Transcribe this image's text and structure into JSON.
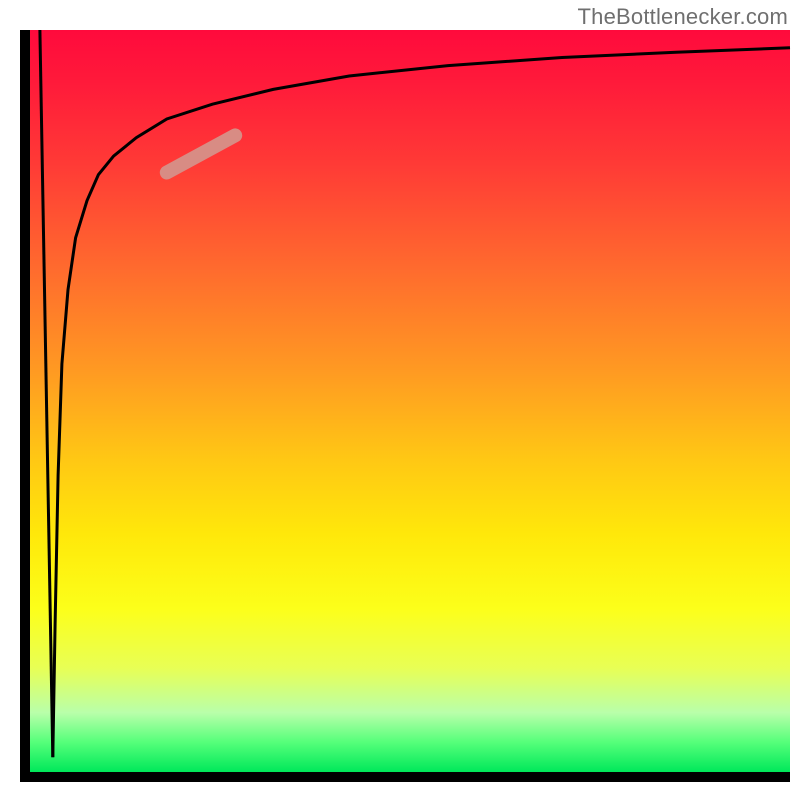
{
  "watermark": "TheBottlenecker.com",
  "chart_data": {
    "type": "line",
    "title": "",
    "xlabel": "",
    "ylabel": "",
    "xlim": [
      0,
      100
    ],
    "ylim": [
      0,
      100
    ],
    "grid": false,
    "legend": false,
    "background_gradient": {
      "direction": "vertical",
      "stops": [
        {
          "pos": 0.0,
          "color": "#ff0a3c"
        },
        {
          "pos": 0.5,
          "color": "#ffb018"
        },
        {
          "pos": 0.8,
          "color": "#f8ff20"
        },
        {
          "pos": 1.0,
          "color": "#00e85a"
        }
      ]
    },
    "series": [
      {
        "name": "bottleneck-curve",
        "color": "#000000",
        "stroke_width": 3,
        "x": [
          3.0,
          3.3,
          3.7,
          4.2,
          5.0,
          6.0,
          7.5,
          9.0,
          11.0,
          14.0,
          18.0,
          24.0,
          32.0,
          42.0,
          55.0,
          70.0,
          85.0,
          100.0
        ],
        "y": [
          2.0,
          20.0,
          40.0,
          55.0,
          65.0,
          72.0,
          77.0,
          80.5,
          83.0,
          85.5,
          88.0,
          90.0,
          92.0,
          93.8,
          95.2,
          96.3,
          97.0,
          97.6
        ]
      },
      {
        "name": "initial-drop",
        "color": "#000000",
        "stroke_width": 3,
        "x": [
          1.3,
          3.0
        ],
        "y": [
          100.0,
          2.0
        ]
      },
      {
        "name": "highlight-segment",
        "color": "#d88c84",
        "stroke_width": 14,
        "linecap": "round",
        "x": [
          18.0,
          27.0
        ],
        "y": [
          80.8,
          85.8
        ]
      }
    ]
  }
}
